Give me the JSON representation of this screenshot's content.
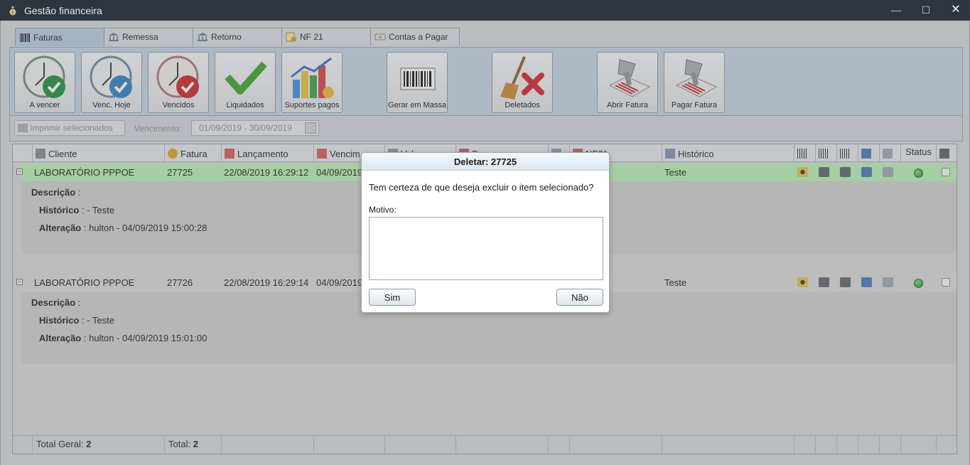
{
  "window": {
    "title": "Gestão financeira",
    "minimize": "—",
    "maximize": "☐",
    "close": "✕"
  },
  "tabs": [
    {
      "label": "Faturas",
      "icon": "barcode-icon"
    },
    {
      "label": "Remessa",
      "icon": "bank-icon"
    },
    {
      "label": "Retorno",
      "icon": "bank-icon"
    },
    {
      "label": "NF 21",
      "icon": "invoice-icon"
    },
    {
      "label": "Contas a Pagar",
      "icon": "cash-icon"
    }
  ],
  "toolbar": {
    "a_vencer": "A vencer",
    "venc_hoje": "Venc. Hoje",
    "vencidos": "Vencidos",
    "liquidados": "Liquidados",
    "suportes_pagos": "Suportes pagos",
    "gerar_em_massa": "Gerar em Massa",
    "deletados": "Deletados",
    "abrir_fatura": "Abrir Fatura",
    "pagar_fatura": "Pagar Fatura"
  },
  "filter": {
    "print_selected": "Imprimir selecionados",
    "vencimento_label": "Vencimento:",
    "vencimento_range": "01/09/2019 - 30/09/2019"
  },
  "grid": {
    "headers": {
      "cliente": "Cliente",
      "fatura": "Fatura",
      "lancamento": "Lançamento",
      "vencimento": "Vencim",
      "valor": "Valor",
      "pagamento": "P",
      "nf": "NF21",
      "historico": "Histórico",
      "status": "Status"
    },
    "rows": [
      {
        "cliente": "LABORATÓRIO PPPOE",
        "fatura": "27725",
        "lancamento": "22/08/2019 16:29:12",
        "vencimento": "04/09/2019",
        "historico": "Teste",
        "descricao_label": "Descrição",
        "descricao": " :",
        "historico_label": "Histórico",
        "historico_detail": " : - Teste",
        "alteracao_label": "Alteração",
        "alteracao": " : hulton - 04/09/2019 15:00:28"
      },
      {
        "cliente": "LABORATÓRIO PPPOE",
        "fatura": "27726",
        "lancamento": "22/08/2019 16:29:14",
        "vencimento": "04/09/2019",
        "historico": "Teste",
        "descricao_label": "Descrição",
        "descricao": " :",
        "historico_label": "Histórico",
        "historico_detail": " : - Teste",
        "alteracao_label": "Alteração",
        "alteracao": " : hulton - 04/09/2019 15:01:00"
      }
    ],
    "footer": {
      "total_geral_label": "Total Geral:",
      "total_geral": "2",
      "total_label": "Total:",
      "total": "2"
    }
  },
  "modal": {
    "title": "Deletar: 27725",
    "message": "Tem certeza de que deseja excluir o item selecionado?",
    "motivo_label": "Motivo:",
    "motivo_value": "",
    "yes": "Sim",
    "no": "Não"
  },
  "colors": {
    "titlebar": "#2f353e",
    "toolbar": "#c3d3e4",
    "selected_row": "#b9f0b5",
    "status_green": "#1f8a1f"
  }
}
